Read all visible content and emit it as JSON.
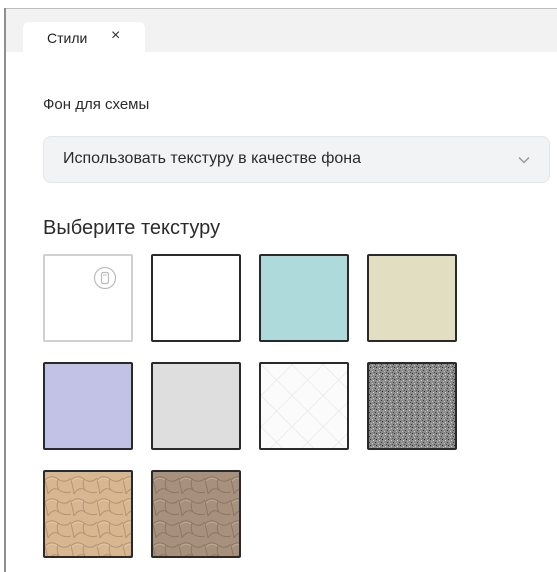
{
  "tab": {
    "label": "Стили",
    "close_glyph": "×"
  },
  "background": {
    "label": "Фон для схемы",
    "selected_option": "Использовать текстуру в качестве фона"
  },
  "textures": {
    "heading": "Выберите текстуру",
    "items": [
      {
        "name": "none",
        "color": "#ffffff",
        "selected": true,
        "icon": "clear-icon"
      },
      {
        "name": "white",
        "color": "#ffffff"
      },
      {
        "name": "light-blue-linen",
        "color": "#aedde0"
      },
      {
        "name": "beige-linen",
        "color": "#e6e1c3"
      },
      {
        "name": "lavender-linen",
        "color": "#c3c3ea"
      },
      {
        "name": "light-gray-linen",
        "color": "#e2e2e2"
      },
      {
        "name": "white-quilted",
        "color": "#fbfbfb"
      },
      {
        "name": "gray-noise",
        "color": "#8a8a8a"
      },
      {
        "name": "tan-leather",
        "color": "#d8b690"
      },
      {
        "name": "brown-leather",
        "color": "#a8917c"
      }
    ]
  }
}
